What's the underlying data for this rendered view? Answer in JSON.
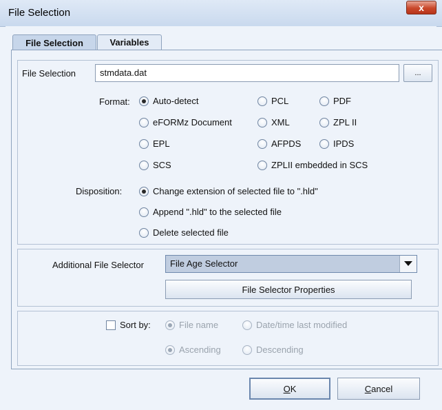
{
  "window": {
    "title": "File Selection",
    "close_glyph": "x"
  },
  "tabs": [
    {
      "label": "File Selection",
      "active": true
    },
    {
      "label": "Variables",
      "active": false
    }
  ],
  "file_selection": {
    "label": "File Selection",
    "value": "stmdata.dat",
    "browse_label": "..."
  },
  "format": {
    "label": "Format:",
    "options": [
      {
        "label": "Auto-detect",
        "selected": true
      },
      {
        "label": "PCL",
        "selected": false
      },
      {
        "label": "PDF",
        "selected": false
      },
      {
        "label": "eFORMz Document",
        "selected": false
      },
      {
        "label": "XML",
        "selected": false
      },
      {
        "label": "ZPL II",
        "selected": false
      },
      {
        "label": "EPL",
        "selected": false
      },
      {
        "label": "AFPDS",
        "selected": false
      },
      {
        "label": "IPDS",
        "selected": false
      },
      {
        "label": "SCS",
        "selected": false
      },
      {
        "label": "ZPLII embedded in SCS",
        "selected": false
      }
    ]
  },
  "disposition": {
    "label": "Disposition:",
    "options": [
      {
        "label": "Change extension of selected file to \".hld\"",
        "selected": true
      },
      {
        "label": "Append \".hld\" to the selected file",
        "selected": false
      },
      {
        "label": "Delete selected file",
        "selected": false
      }
    ]
  },
  "additional_selector": {
    "label": "Additional File Selector",
    "selected_value": "File Age Selector",
    "properties_button": "File Selector Properties"
  },
  "sort": {
    "checkbox_label": "Sort by:",
    "checked": false,
    "field_options": [
      {
        "label": "File name",
        "selected": true
      },
      {
        "label": "Date/time last modified",
        "selected": false
      }
    ],
    "order_options": [
      {
        "label": "Ascending",
        "selected": true
      },
      {
        "label": "Descending",
        "selected": false
      }
    ]
  },
  "buttons": {
    "ok_mnemonic": "O",
    "ok_rest": "K",
    "cancel_mnemonic": "C",
    "cancel_rest": "ancel"
  }
}
